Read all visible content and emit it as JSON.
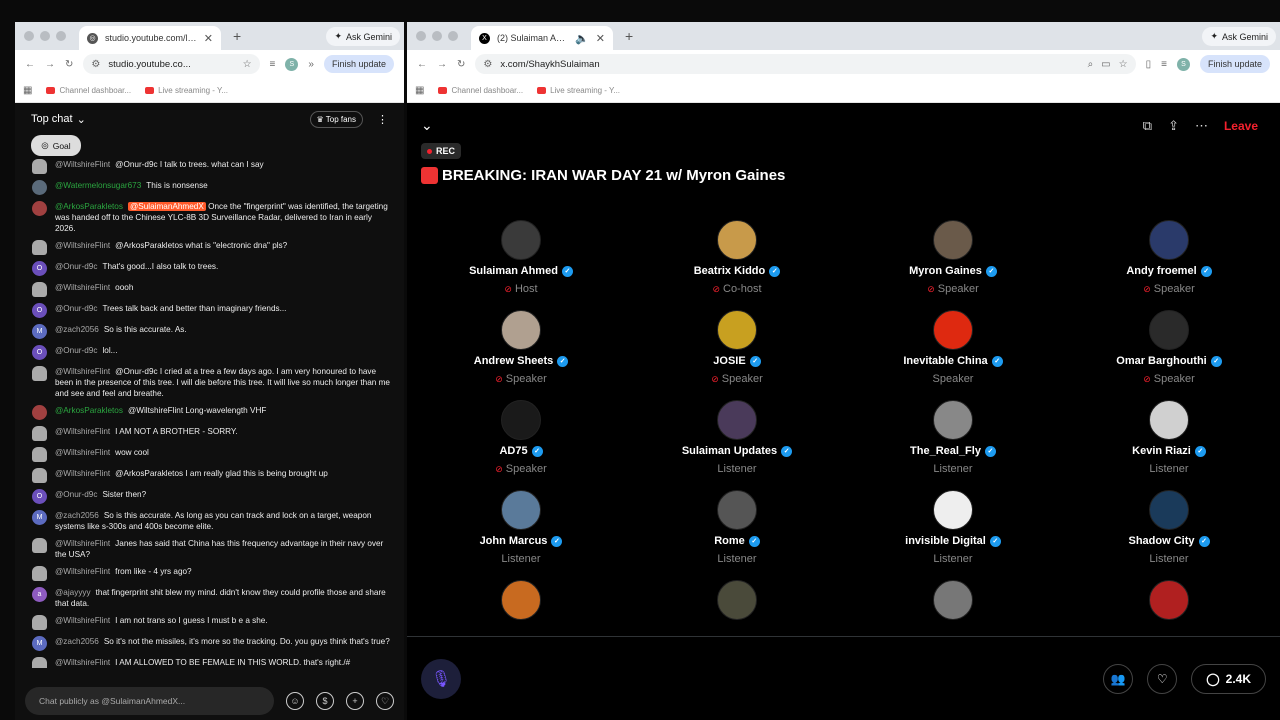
{
  "left_browser": {
    "tab_title": "studio.youtube.com/live_chat",
    "ask_gemini": "Ask Gemini",
    "url": "studio.youtube.co...",
    "finish_update": "Finish update",
    "profile": "S",
    "bookmarks": [
      "Channel dashboar...",
      "Live streaming - Y..."
    ]
  },
  "right_browser": {
    "tab_title": "(2) Sulaiman Ahmed (@S",
    "ask_gemini": "Ask Gemini",
    "url": "x.com/ShaykhSulaiman",
    "finish_update": "Finish update",
    "profile": "S",
    "bookmarks": [
      "Channel dashboar...",
      "Live streaming - Y..."
    ]
  },
  "chat": {
    "title": "Top chat",
    "top_fans": "Top fans",
    "goal": "Goal",
    "input_placeholder": "Chat publicly as @SulaimanAhmedX...",
    "messages": [
      {
        "av": "hat",
        "author": "@WiltshireFlint",
        "g": false,
        "text": "@Onur-d9c I talk to trees. what can I say"
      },
      {
        "av": "wm",
        "author": "@Watermelonsugar673",
        "g": true,
        "text": "This is nonsense"
      },
      {
        "av": "ap",
        "author": "@ArkosParakletos",
        "g": true,
        "tag": "@SulaimanAhmedX",
        "text": "Once the \"fingerprint\" was identified, the targeting was handed off to the Chinese YLC-8B 3D Surveillance Radar, delivered to Iran in early 2026."
      },
      {
        "av": "hat",
        "author": "@WiltshireFlint",
        "g": false,
        "text": "@ArkosParakletos what is \"electronic dna\" pls?"
      },
      {
        "av": "o",
        "author": "@Onur-d9c",
        "g": false,
        "text": "That's good...I also talk to trees."
      },
      {
        "av": "hat",
        "author": "@WiltshireFlint",
        "g": false,
        "text": "oooh"
      },
      {
        "av": "o",
        "author": "@Onur-d9c",
        "g": false,
        "text": "Trees talk back and better than imaginary friends..."
      },
      {
        "av": "m",
        "author": "@zach2056",
        "g": false,
        "text": "So is this accurate. As."
      },
      {
        "av": "o",
        "author": "@Onur-d9c",
        "g": false,
        "text": "lol..."
      },
      {
        "av": "hat",
        "author": "@WiltshireFlint",
        "g": false,
        "text": "@Onur-d9c I cried at a tree a few days ago. I am very honoured to have been in the presence of this tree. I will die before this tree. It will live so much longer than me and see and feel and breathe."
      },
      {
        "av": "ap",
        "author": "@ArkosParakletos",
        "g": true,
        "text": "@WiltshireFlint Long-wavelength VHF"
      },
      {
        "av": "hat",
        "author": "@WiltshireFlint",
        "g": false,
        "text": "I AM NOT A BROTHER - SORRY."
      },
      {
        "av": "hat",
        "author": "@WiltshireFlint",
        "g": false,
        "text": "wow cool"
      },
      {
        "av": "hat",
        "author": "@WiltshireFlint",
        "g": false,
        "text": "@ArkosParakletos I am really glad this is being brought up"
      },
      {
        "av": "o",
        "author": "@Onur-d9c",
        "g": false,
        "text": "Sister then?"
      },
      {
        "av": "m",
        "author": "@zach2056",
        "g": false,
        "text": "So is this accurate. As long as you can track and lock on a target, weapon systems like s-300s and 400s become elite."
      },
      {
        "av": "hat",
        "author": "@WiltshireFlint",
        "g": false,
        "text": "Janes has said that China has this frequency advantage in their navy over the USA?"
      },
      {
        "av": "hat",
        "author": "@WiltshireFlint",
        "g": false,
        "text": "from like - 4 yrs ago?"
      },
      {
        "av": "a",
        "author": "@ajayyyy",
        "g": false,
        "text": "that fingerprint shit blew my mind. didn't know they could profile those and share that data."
      },
      {
        "av": "hat",
        "author": "@WiltshireFlint",
        "g": false,
        "text": "I am not trans so I guess I must b e a she."
      },
      {
        "av": "m",
        "author": "@zach2056",
        "g": false,
        "text": "So it's not the missiles, it's more so the tracking. Do. you guys think that's true?"
      },
      {
        "av": "hat",
        "author": "@WiltshireFlint",
        "g": false,
        "text": "I AM ALLOWED TO BE FEMALE IN THIS WORLD. that's right./#"
      }
    ]
  },
  "space": {
    "leave": "Leave",
    "rec": "REC",
    "title": "BREAKING: IRAN WAR DAY 21 w/ Myron Gaines",
    "count": "2.4K",
    "participants": [
      {
        "name": "Sulaiman Ahmed",
        "role": "Host",
        "muted": true,
        "color": "#3a3a3a"
      },
      {
        "name": "Beatrix Kiddo",
        "role": "Co-host",
        "muted": true,
        "color": "#c89a4a"
      },
      {
        "name": "Myron Gaines",
        "role": "Speaker",
        "muted": true,
        "color": "#6a5a4a"
      },
      {
        "name": "Andy froemel",
        "role": "Speaker",
        "muted": true,
        "color": "#2a3a6a"
      },
      {
        "name": "Andrew Sheets",
        "role": "Speaker",
        "muted": true,
        "color": "#b0a090"
      },
      {
        "name": "JOSIE",
        "role": "Speaker",
        "muted": true,
        "color": "#c8a020"
      },
      {
        "name": "Inevitable China",
        "role": "Speaker",
        "muted": false,
        "color": "#de2910"
      },
      {
        "name": "Omar Barghouthi",
        "role": "Speaker",
        "muted": true,
        "color": "#2a2a2a"
      },
      {
        "name": "AD75",
        "role": "Speaker",
        "muted": true,
        "color": "#1a1a1a"
      },
      {
        "name": "Sulaiman Updates",
        "role": "Listener",
        "muted": false,
        "color": "#4a3a5a"
      },
      {
        "name": "The_Real_Fly",
        "role": "Listener",
        "muted": false,
        "color": "#888888"
      },
      {
        "name": "Kevin Riazi",
        "role": "Listener",
        "muted": false,
        "color": "#d0d0d0"
      },
      {
        "name": "John Marcus",
        "role": "Listener",
        "muted": false,
        "color": "#5a7a9a"
      },
      {
        "name": "Rome",
        "role": "Listener",
        "muted": false,
        "color": "#555555"
      },
      {
        "name": "invisible Digital",
        "role": "Listener",
        "muted": false,
        "color": "#eeeeee"
      },
      {
        "name": "Shadow City",
        "role": "Listener",
        "muted": false,
        "color": "#1a3a5a"
      },
      {
        "name": "",
        "role": "",
        "muted": false,
        "color": "#c86a20"
      },
      {
        "name": "",
        "role": "",
        "muted": false,
        "color": "#4a4a3a"
      },
      {
        "name": "",
        "role": "",
        "muted": false,
        "color": "#777777"
      },
      {
        "name": "",
        "role": "",
        "muted": false,
        "color": "#b02020"
      }
    ]
  }
}
